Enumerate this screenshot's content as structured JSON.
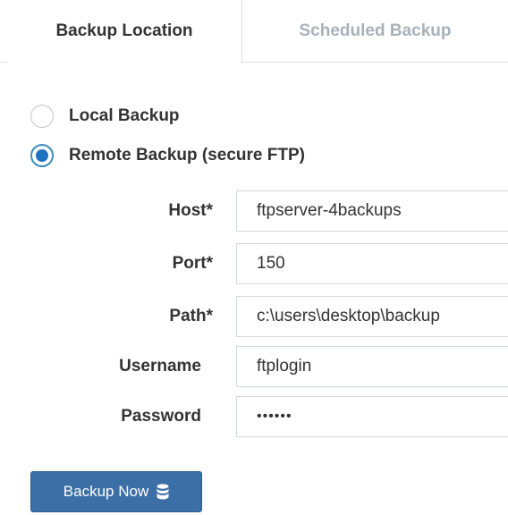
{
  "tabs": [
    {
      "label": "Backup Location",
      "active": true
    },
    {
      "label": "Scheduled Backup",
      "active": false
    }
  ],
  "backup_type": {
    "options": [
      {
        "label": "Local Backup",
        "checked": false
      },
      {
        "label": "Remote Backup (secure FTP)",
        "checked": true
      }
    ]
  },
  "form": {
    "host": {
      "label": "Host*",
      "value": "ftpserver-4backups"
    },
    "port": {
      "label": "Port*",
      "value": "150"
    },
    "path": {
      "label": "Path*",
      "value": "c:\\users\\desktop\\backup"
    },
    "username": {
      "label": "Username",
      "value": "ftplogin"
    },
    "password": {
      "label": "Password",
      "value": "••••••"
    }
  },
  "actions": {
    "backup_now_label": "Backup Now",
    "backup_now_icon": "database-icon"
  },
  "colors": {
    "accent": "#1e73be",
    "button_bg": "#3c6fa5",
    "inactive_tab_text": "#a9b1b9",
    "text": "#333333",
    "border": "#d2d6de"
  }
}
